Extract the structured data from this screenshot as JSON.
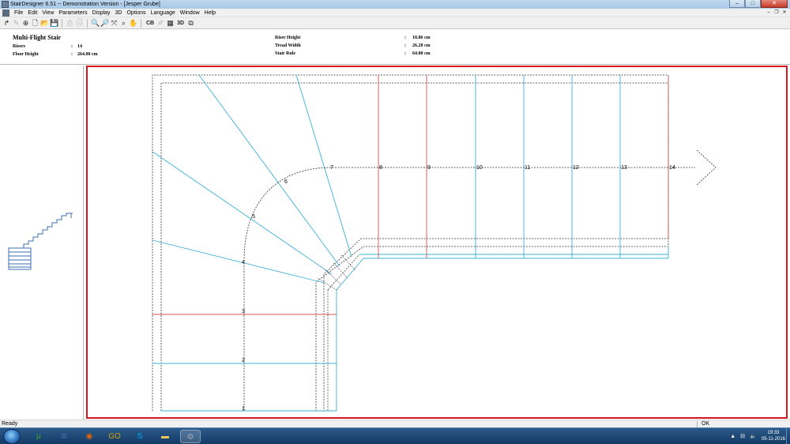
{
  "window": {
    "title": "StairDesigner 6.51 -- Demonstration Version - [Jesper Grube]",
    "controls": {
      "minimize": "–",
      "maximize": "□",
      "close": "✕"
    }
  },
  "menu": {
    "items": [
      "File",
      "Edit",
      "View",
      "Parameters",
      "Display",
      "3D",
      "Options",
      "Language",
      "Window",
      "Help"
    ],
    "mdi_controls": {
      "minimize": "–",
      "restore": "❐",
      "close": "✕"
    }
  },
  "toolbar": {
    "buttons": [
      {
        "name": "new-project",
        "icon": "new-icon",
        "glyph": "↱",
        "enabled": true
      },
      {
        "name": "edit-tool",
        "icon": "pencil-icon",
        "glyph": "✎",
        "enabled": false
      },
      {
        "name": "walkline",
        "icon": "target-icon",
        "glyph": "⊕",
        "enabled": true
      },
      {
        "name": "new-file",
        "icon": "new-file-icon",
        "glyph": "🗋",
        "enabled": true
      },
      {
        "name": "open-file",
        "icon": "folder-icon",
        "glyph": "📂",
        "enabled": true
      },
      {
        "name": "save-file",
        "icon": "save-icon",
        "glyph": "💾",
        "enabled": true
      },
      {
        "name": "print",
        "icon": "printer-icon",
        "glyph": "⎙",
        "enabled": false
      },
      {
        "name": "print-preview",
        "icon": "preview-icon",
        "glyph": "🗐",
        "enabled": false
      },
      {
        "name": "zoom-in",
        "icon": "zoom-in-icon",
        "glyph": "🔍",
        "enabled": true
      },
      {
        "name": "zoom-out",
        "icon": "zoom-out-icon",
        "glyph": "🔎",
        "enabled": true
      },
      {
        "name": "zoom-fit",
        "icon": "fit-icon",
        "glyph": "⤧",
        "enabled": true
      },
      {
        "name": "zoom-window",
        "icon": "zoom-window-icon",
        "glyph": "⌕",
        "enabled": true
      },
      {
        "name": "pan",
        "icon": "hand-icon",
        "glyph": "✋",
        "enabled": true
      },
      {
        "name": "cb",
        "icon": "cb-icon",
        "glyph": "CB",
        "enabled": true
      },
      {
        "name": "pen",
        "icon": "pen-icon",
        "glyph": "✐",
        "enabled": false
      },
      {
        "name": "stair-view",
        "icon": "stair-icon",
        "glyph": "▦",
        "enabled": true
      },
      {
        "name": "3d-view",
        "icon": "3d-icon",
        "glyph": "3D",
        "enabled": true
      },
      {
        "name": "copy",
        "icon": "copy-icon",
        "glyph": "⧉",
        "enabled": true
      }
    ]
  },
  "info": {
    "heading": "Multi-Flight Stair",
    "fields": [
      {
        "label": "Risers",
        "value": "14"
      },
      {
        "label": "Floor Height",
        "value": "264.00 cm"
      },
      {
        "label": "Riser Height",
        "value": "18.86 cm"
      },
      {
        "label": "Tread Width",
        "value": "26.28 cm"
      },
      {
        "label": "Stair Rule",
        "value": "64.00 cm"
      }
    ],
    "colon": ":"
  },
  "plan": {
    "step_numbers": [
      "1",
      "2",
      "3",
      "4",
      "5",
      "6",
      "7",
      "8",
      "9",
      "10",
      "11",
      "12",
      "13",
      "14"
    ],
    "colors": {
      "tread": "#3cb0d8",
      "landing": "#d9534f",
      "outline": "#333333",
      "frame": "#d4171f"
    }
  },
  "status": {
    "text": "Ready",
    "ok": "OK"
  },
  "taskbar": {
    "apps": [
      {
        "name": "utorrent",
        "icon": "utorrent-icon",
        "glyph": "µ",
        "color": "#3fa535"
      },
      {
        "name": "discord",
        "icon": "discord-icon",
        "glyph": "☺",
        "color": "#7289da"
      },
      {
        "name": "firefox",
        "icon": "firefox-icon",
        "glyph": "◉",
        "color": "#e66000"
      },
      {
        "name": "go-app",
        "icon": "go-icon",
        "glyph": "GO",
        "color": "#d8a200"
      },
      {
        "name": "skype",
        "icon": "skype-icon",
        "glyph": "S",
        "color": "#00aff0"
      },
      {
        "name": "explorer",
        "icon": "folder-icon",
        "glyph": "▬",
        "color": "#e8c35a"
      },
      {
        "name": "stairdesigner",
        "icon": "stairdesigner-icon",
        "glyph": "⚙",
        "color": "#9aa7b5"
      }
    ],
    "clock_time": "19:33",
    "clock_date": "05-11-2016"
  }
}
